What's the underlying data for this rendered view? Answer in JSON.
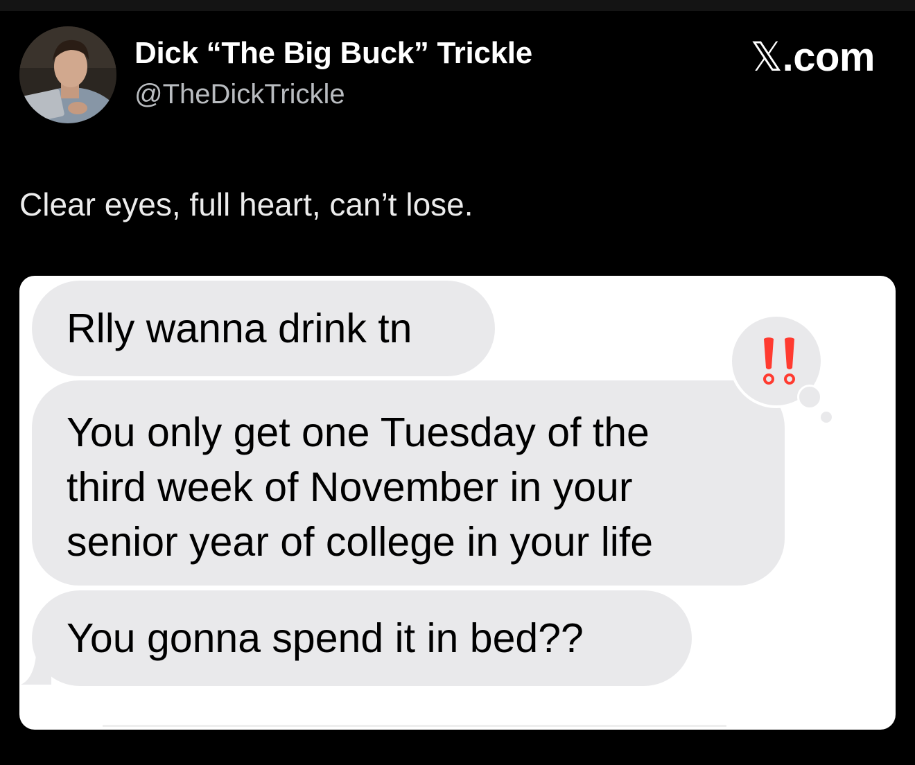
{
  "author": {
    "name": "Dick “The Big Buck” Trickle",
    "handle": "@TheDickTrickle"
  },
  "brand": {
    "logo_glyph": "𝕏",
    "domain_suffix": ".com"
  },
  "tweet": {
    "text": "Clear eyes, full heart, can’t lose."
  },
  "messages": [
    {
      "text": "Rlly wanna drink tn"
    },
    {
      "lines": [
        "You only get one Tuesday of the",
        "third week of November in your",
        "senior year of college in your life"
      ]
    },
    {
      "text": "You gonna spend it in bed??"
    }
  ],
  "reaction": {
    "icon": "double-exclamation-icon",
    "color": "#ff3b30"
  },
  "colors": {
    "background": "#000000",
    "bubble": "#e9e9eb",
    "card": "#ffffff",
    "handle": "#b9bcc0"
  }
}
